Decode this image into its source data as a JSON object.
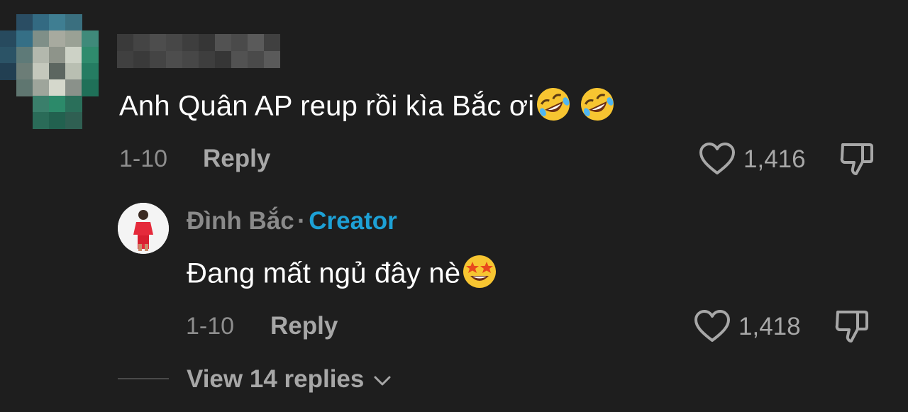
{
  "comment": {
    "author": "",
    "text": "Anh Quân AP reup rồi kìa Bắc ơi",
    "emojis": [
      "rolling-on-floor-laughing-emoji",
      "rolling-on-floor-laughing-emoji"
    ],
    "date": "1-10",
    "reply_label": "Reply",
    "like_count": "1,416"
  },
  "reply": {
    "author": "Đình Bắc",
    "separator": "·",
    "badge": "Creator",
    "text": "Đang mất ngủ đây nè",
    "emojis": [
      "star-struck-emoji"
    ],
    "date": "1-10",
    "reply_label": "Reply",
    "like_count": "1,418"
  },
  "view_replies": {
    "label": "View 14 replies"
  },
  "colors": {
    "background": "#1e1e1e",
    "text": "#ffffff",
    "muted": "#8e8e8e",
    "creator_badge": "#1da1d6"
  }
}
